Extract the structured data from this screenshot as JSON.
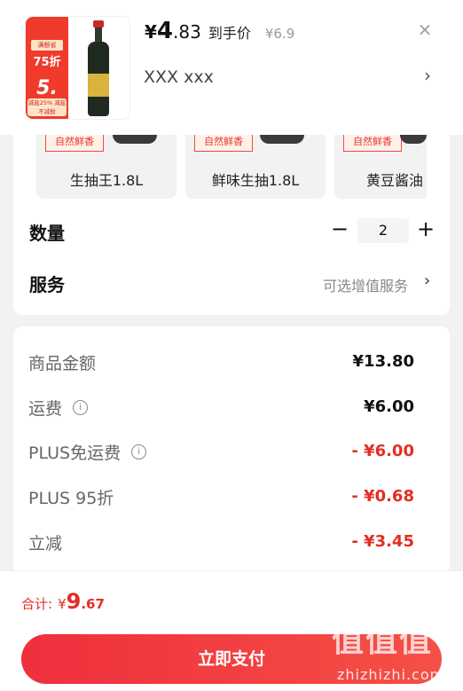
{
  "header": {
    "thumbnail": {
      "promo_top": "满额省",
      "promo_discount": "75折",
      "promo_price": "5.",
      "promo_foot": "减盐25% 减盐不减鲜"
    },
    "price_yen": "¥",
    "price_int": "4",
    "price_dec": ".83",
    "price_label": "到手价",
    "original_price": "¥6.9",
    "variant_text": "XXX  xxx",
    "close_icon": "×",
    "chevron": "›"
  },
  "options": [
    {
      "badge": "自然鲜香",
      "label": "生抽王1.8L"
    },
    {
      "badge": "自然鲜香",
      "label": "鲜味生抽1.8L"
    },
    {
      "badge": "自然鲜香",
      "label": "黄豆酱油"
    }
  ],
  "quantity": {
    "label": "数量",
    "value": "2",
    "minus": "−",
    "plus": "+"
  },
  "service": {
    "label": "服务",
    "hint": "可选增值服务",
    "chevron": "›"
  },
  "breakdown": [
    {
      "label": "商品金额",
      "value": "¥13.80",
      "info": false,
      "red": false
    },
    {
      "label": "运费",
      "value": "¥6.00",
      "info": true,
      "red": false
    },
    {
      "label": "PLUS免运费",
      "value": "- ¥6.00",
      "info": true,
      "red": true
    },
    {
      "label": "PLUS 95折",
      "value": "- ¥0.68",
      "info": false,
      "red": true
    },
    {
      "label": "立减",
      "value": "- ¥3.45",
      "info": false,
      "red": true
    }
  ],
  "footer": {
    "total_label": "合计:",
    "total_yen": "¥",
    "total_int": "9",
    "total_dec": ".67",
    "pay_button": "立即支付",
    "watermark": "值值值",
    "watermark_site": "zhizhizhi.com"
  },
  "colors": {
    "accent": "#e42d22",
    "pay_button": "#ef2f3d"
  }
}
